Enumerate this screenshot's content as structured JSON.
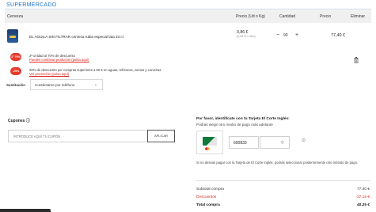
{
  "section": {
    "title": "SUPERMERCADO"
  },
  "table": {
    "col_product": "Cerveza",
    "col_unit_price": "Precio (Ud o Kg)",
    "col_quantity": "Cantidad",
    "col_price": "Precio",
    "col_remove": "Eliminar"
  },
  "product": {
    "name": "EL AGUILA SIN FILTRAR cerveza rubia especial lata 33 cl",
    "unit_price": "0,86 €",
    "unit_price_detail": "(2,61 € / Litro)",
    "quantity": "90",
    "minus_label": "−",
    "plus_label": "+",
    "total": "77,40 €"
  },
  "promos": [
    {
      "badge": "2ª 70%",
      "text": "2ª unidad al 70% de descuento",
      "link": "Puedes combinar productos (pulsa aquí)"
    },
    {
      "badge": "-25%",
      "text": "20% de descuento por compras superiores a 60 € en aguas, refrescos, zumos y cervezas",
      "link": "Ver promoción (pulsa aquí)"
    }
  ],
  "substitution": {
    "label": "Sustitución",
    "value": "Contáctame por teléfono"
  },
  "coupons": {
    "title": "Cupones ⓘ",
    "placeholder": "INTRODUCE AQUÍ TU CUPÓN",
    "apply": "APLICAR"
  },
  "identify": {
    "title": "Por favor, identifícate con tu Tarjeta El Corte Inglés:",
    "subtitle": "Podrás elegir otro medio de pago más adelante",
    "card_number": "600833",
    "note": "Si no deseas pagar con la Tarjeta de El Corte Inglés, podrás seleccionar posteriormente otro método de pago."
  },
  "summary": {
    "subtotal_label": "Subtotal compra",
    "subtotal_value": "77,40 €",
    "discount_label": "Descuentos",
    "discount_value": "-37,15 €",
    "total_label": "Total compra",
    "total_value": "40,25 €"
  },
  "colors": {
    "accent": "#1a73c9",
    "promo_red": "#e63a2c",
    "link_red": "#d9251c"
  }
}
